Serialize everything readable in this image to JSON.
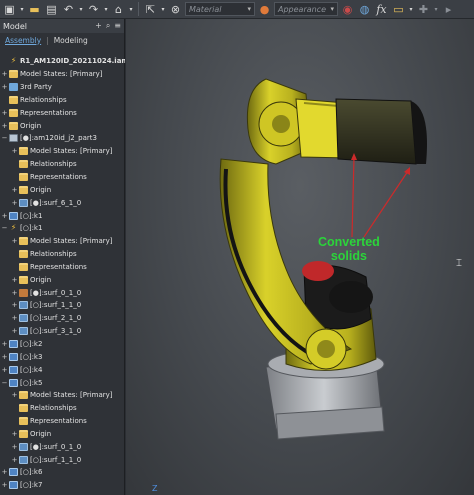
{
  "toolbar": {
    "material_placeholder": "Material",
    "appearance_placeholder": "Appearance",
    "fx_label": "fx"
  },
  "panel": {
    "title": "Model",
    "tabs": [
      {
        "label": "Assembly",
        "active": true
      },
      {
        "label": "Modeling",
        "active": false
      }
    ]
  },
  "tree": [
    {
      "indent": 0,
      "exp": "",
      "icon": "lightning",
      "label": "R1_AM120ID_20211024.iam",
      "bold": true
    },
    {
      "indent": 0,
      "exp": "+",
      "icon": "folder",
      "label": "Model States: [Primary]"
    },
    {
      "indent": 0,
      "exp": "+",
      "icon": "part",
      "label": "3rd Party"
    },
    {
      "indent": 0,
      "exp": "",
      "icon": "folder",
      "label": "Relationships"
    },
    {
      "indent": 0,
      "exp": "+",
      "icon": "folder",
      "label": "Representations"
    },
    {
      "indent": 0,
      "exp": "+",
      "icon": "folder",
      "label": "Origin"
    },
    {
      "indent": 0,
      "exp": "−",
      "icon": "asm",
      "label": "[●]:am120id_j2_part3"
    },
    {
      "indent": 1,
      "exp": "+",
      "icon": "folder",
      "label": "Model States: [Primary]"
    },
    {
      "indent": 1,
      "exp": "",
      "icon": "folder",
      "label": "Relationships"
    },
    {
      "indent": 1,
      "exp": "",
      "icon": "folder",
      "label": "Representations"
    },
    {
      "indent": 1,
      "exp": "+",
      "icon": "folder",
      "label": "Origin"
    },
    {
      "indent": 1,
      "exp": "+",
      "icon": "surf",
      "label": "[●]:surf_6_1_0"
    },
    {
      "indent": 0,
      "exp": "+",
      "icon": "cube",
      "label": "[○]:k1"
    },
    {
      "indent": 0,
      "exp": "−",
      "icon": "lightning",
      "label": "[○]:k1"
    },
    {
      "indent": 1,
      "exp": "+",
      "icon": "folder",
      "label": "Model States: [Primary]"
    },
    {
      "indent": 1,
      "exp": "",
      "icon": "folder",
      "label": "Relationships"
    },
    {
      "indent": 1,
      "exp": "",
      "icon": "folder",
      "label": "Representations"
    },
    {
      "indent": 1,
      "exp": "+",
      "icon": "folder",
      "label": "Origin"
    },
    {
      "indent": 1,
      "exp": "+",
      "icon": "edit",
      "label": "[●]:surf_0_1_0"
    },
    {
      "indent": 1,
      "exp": "+",
      "icon": "surf",
      "label": "[○]:surf_1_1_0"
    },
    {
      "indent": 1,
      "exp": "+",
      "icon": "surf",
      "label": "[○]:surf_2_1_0"
    },
    {
      "indent": 1,
      "exp": "+",
      "icon": "surf",
      "label": "[○]:surf_3_1_0"
    },
    {
      "indent": 0,
      "exp": "+",
      "icon": "cube",
      "label": "[○]:k2"
    },
    {
      "indent": 0,
      "exp": "+",
      "icon": "cube",
      "label": "[○]:k3"
    },
    {
      "indent": 0,
      "exp": "+",
      "icon": "cube",
      "label": "[○]:k4"
    },
    {
      "indent": 0,
      "exp": "−",
      "icon": "cube",
      "label": "[○]:k5"
    },
    {
      "indent": 1,
      "exp": "+",
      "icon": "folder",
      "label": "Model States: [Primary]"
    },
    {
      "indent": 1,
      "exp": "",
      "icon": "folder",
      "label": "Relationships"
    },
    {
      "indent": 1,
      "exp": "",
      "icon": "folder",
      "label": "Representations"
    },
    {
      "indent": 1,
      "exp": "+",
      "icon": "folder",
      "label": "Origin"
    },
    {
      "indent": 1,
      "exp": "+",
      "icon": "surf",
      "label": "[●]:surf_0_1_0"
    },
    {
      "indent": 1,
      "exp": "+",
      "icon": "surf",
      "label": "[○]:surf_1_1_0"
    },
    {
      "indent": 0,
      "exp": "+",
      "icon": "cube",
      "label": "[○]:k6"
    },
    {
      "indent": 0,
      "exp": "+",
      "icon": "cube",
      "label": "[○]:k7"
    }
  ],
  "viewport": {
    "annotation": "Converted\nsolids",
    "annotation_color": "#2bd43a",
    "arrow_color": "#cc2a2a",
    "robot_color": "#d9d12a",
    "axis_label": "Z"
  }
}
